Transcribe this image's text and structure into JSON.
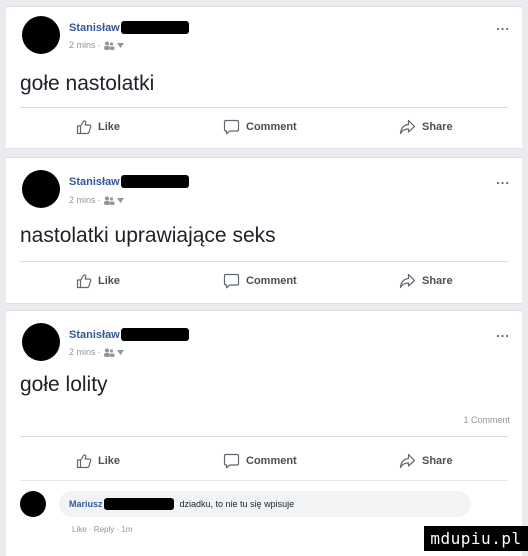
{
  "posts": [
    {
      "author": "Stanisław",
      "time": "2 mins",
      "text": "gołe nastolatki",
      "more": "...",
      "actions": {
        "like": "Like",
        "comment": "Comment",
        "share": "Share"
      }
    },
    {
      "author": "Stanisław",
      "time": "2 mins",
      "text": "nastolatki uprawiające seks",
      "more": "...",
      "actions": {
        "like": "Like",
        "comment": "Comment",
        "share": "Share"
      }
    },
    {
      "author": "Stanisław",
      "time": "2 mins",
      "text": "gołe lolity",
      "more": "...",
      "comment_count": "1 Comment",
      "actions": {
        "like": "Like",
        "comment": "Comment",
        "share": "Share"
      },
      "comment": {
        "author": "Mariusz",
        "text": "dziadku, to nie tu się wpisuje",
        "meta": "Like · Reply · 1m"
      }
    }
  ],
  "watermark": "mdupiu.pl",
  "colors": {
    "link": "#365899",
    "muted": "#90949c",
    "background": "#e9ebee"
  }
}
